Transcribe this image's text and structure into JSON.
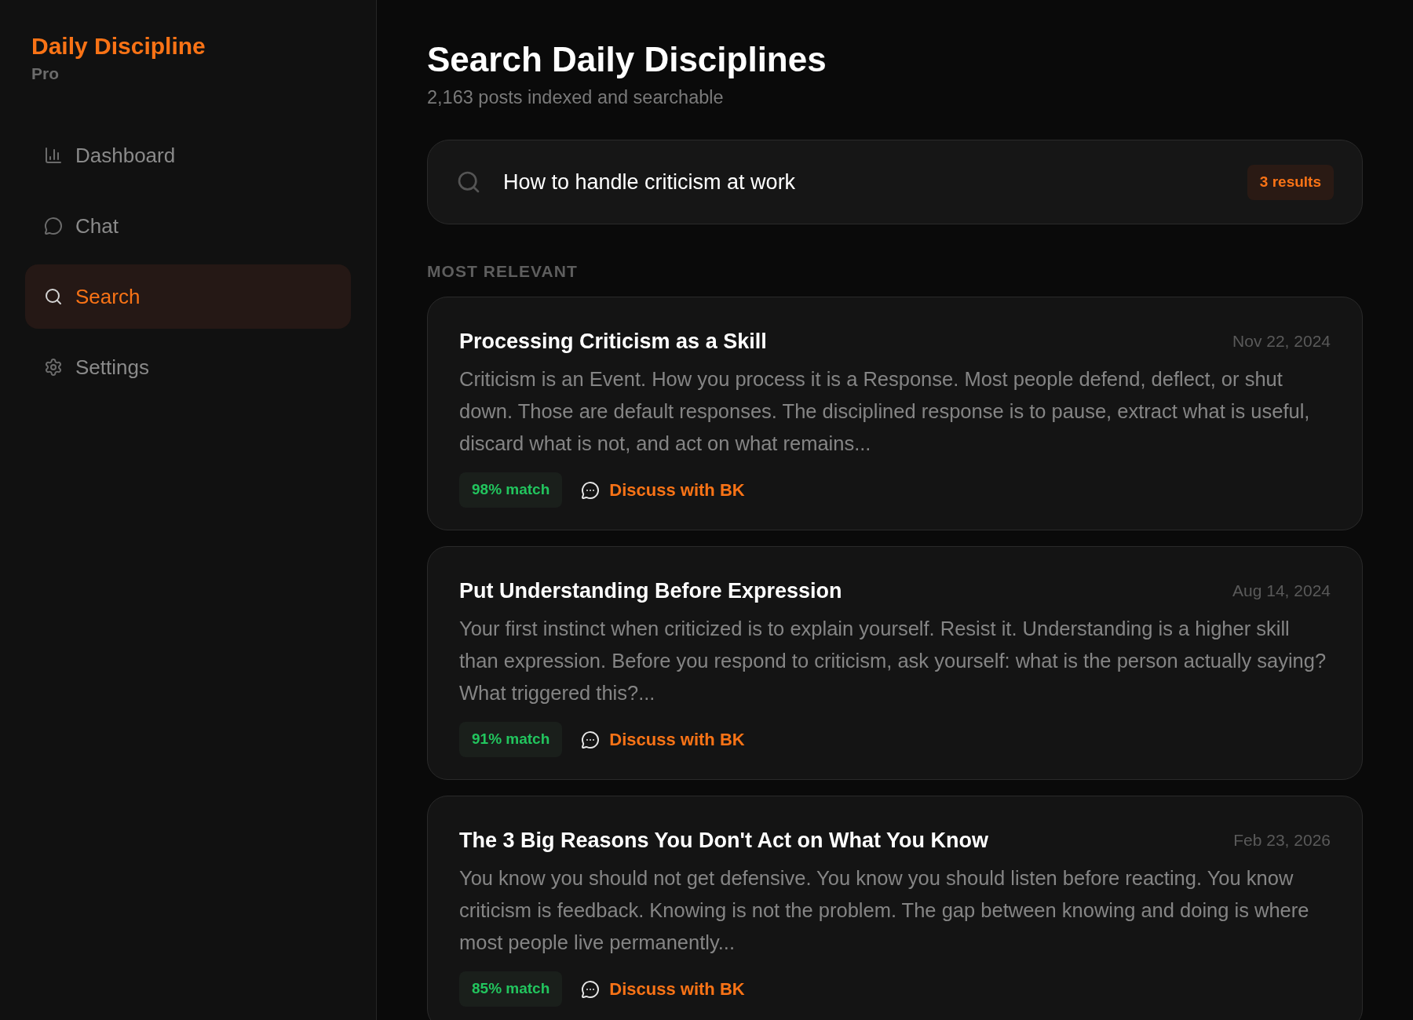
{
  "brand": {
    "name": "Daily Discipline",
    "tier": "Pro"
  },
  "nav": [
    {
      "kind": "dashboard",
      "label": "Dashboard",
      "selected": false
    },
    {
      "kind": "chat",
      "label": "Chat",
      "selected": false
    },
    {
      "kind": "search",
      "label": "Search",
      "selected": true
    },
    {
      "kind": "settings",
      "label": "Settings",
      "selected": false
    }
  ],
  "header": {
    "title": "Search Daily Disciplines",
    "subtitle": "2,163 posts indexed and searchable"
  },
  "search": {
    "value": "How to handle criticism at work",
    "count": "3 results"
  },
  "section": "MOST RELEVANT",
  "results": [
    {
      "title": "Processing Criticism as a Skill",
      "date": "Nov 22, 2024",
      "excerpt": "Criticism is an Event. How you process it is a Response. Most people defend, deflect, or shut down. Those are default responses. The disciplined response is to pause, extract what is useful, discard what is not, and act on what remains...",
      "match": "98% match",
      "action": "Discuss with BK"
    },
    {
      "title": "Put Understanding Before Expression",
      "date": "Aug 14, 2024",
      "excerpt": "Your first instinct when criticized is to explain yourself. Resist it. Understanding is a higher skill than expression. Before you respond to criticism, ask yourself: what is the person actually saying? What triggered this?...",
      "match": "91% match",
      "action": "Discuss with BK"
    },
    {
      "title": "The 3 Big Reasons You Don't Act on What You Know",
      "date": "Feb 23, 2026",
      "excerpt": "You know you should not get defensive. You know you should listen before reacting. You know criticism is feedback. Knowing is not the problem. The gap between knowing and doing is where most people live permanently...",
      "match": "85% match",
      "action": "Discuss with BK"
    }
  ]
}
